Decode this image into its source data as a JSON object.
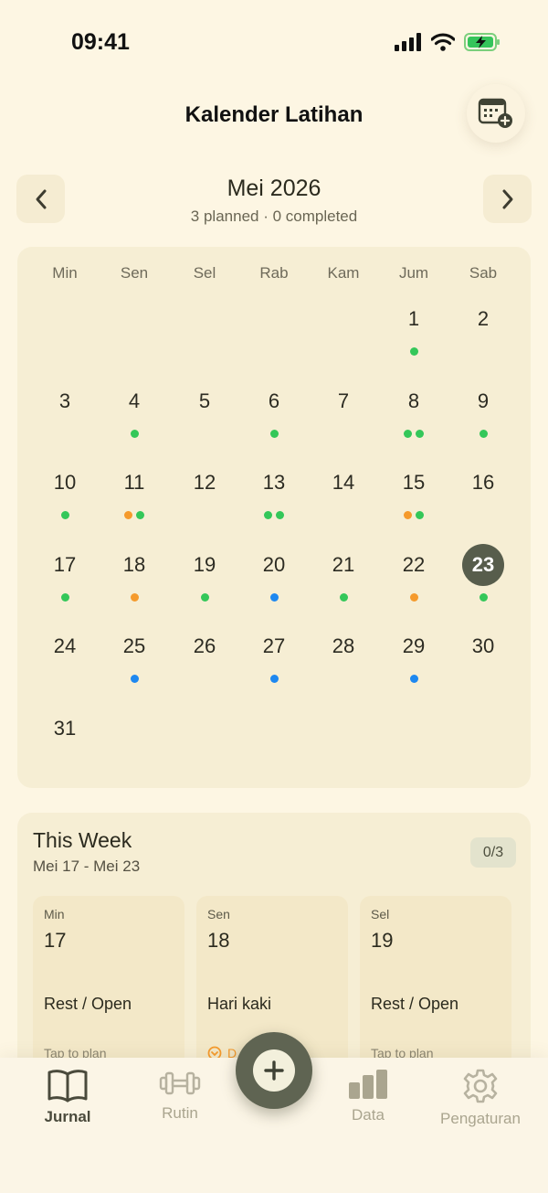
{
  "status_bar": {
    "time": "09:41"
  },
  "header": {
    "title": "Kalender Latihan",
    "add_icon": "calendar-plus-icon"
  },
  "month_nav": {
    "title": "Mei 2026",
    "subtitle": "3 planned · 0 completed"
  },
  "colors": {
    "green": "#34c759",
    "orange": "#f59a2c",
    "blue": "#1e88f0",
    "selected": "#575d4c",
    "accent": "#5f6452"
  },
  "calendar": {
    "weekdays": [
      "Min",
      "Sen",
      "Sel",
      "Rab",
      "Kam",
      "Jum",
      "Sab"
    ],
    "selected_day": "23",
    "days": [
      "1",
      "2",
      "3",
      "4",
      "5",
      "6",
      "7",
      "8",
      "9",
      "10",
      "11",
      "12",
      "13",
      "14",
      "15",
      "16",
      "17",
      "18",
      "19",
      "20",
      "21",
      "22",
      "23",
      "24",
      "25",
      "26",
      "27",
      "28",
      "29",
      "30",
      "31"
    ],
    "markers": {
      "1": [
        "green"
      ],
      "4": [
        "green"
      ],
      "6": [
        "green"
      ],
      "8": [
        "green",
        "green"
      ],
      "9": [
        "green"
      ],
      "10": [
        "green"
      ],
      "11": [
        "orange",
        "green"
      ],
      "13": [
        "green",
        "green"
      ],
      "15": [
        "orange",
        "green"
      ],
      "17": [
        "green"
      ],
      "18": [
        "orange"
      ],
      "19": [
        "green"
      ],
      "20": [
        "blue"
      ],
      "21": [
        "green"
      ],
      "22": [
        "orange"
      ],
      "23": [
        "green"
      ],
      "25": [
        "blue"
      ],
      "27": [
        "blue"
      ],
      "29": [
        "blue"
      ]
    }
  },
  "week": {
    "title": "This Week",
    "range": "Mei 17 - Mei 23",
    "progress": "0/3",
    "cards": [
      {
        "weekday": "Min",
        "date": "17",
        "plan": "Rest / Open",
        "hint": "Tap to plan"
      },
      {
        "weekday": "Sen",
        "date": "18",
        "plan": "Hari kaki",
        "hint": "D"
      },
      {
        "weekday": "Sel",
        "date": "19",
        "plan": "Rest / Open",
        "hint": "Tap to plan"
      }
    ]
  },
  "tabs": [
    {
      "label": "Jurnal",
      "icon": "book-icon",
      "active": true
    },
    {
      "label": "Rutin",
      "icon": "dumbbell-icon",
      "active": false
    },
    {
      "label": "Data",
      "icon": "bar-chart-icon",
      "active": false
    },
    {
      "label": "Pengaturan",
      "icon": "gear-icon",
      "active": false
    }
  ]
}
